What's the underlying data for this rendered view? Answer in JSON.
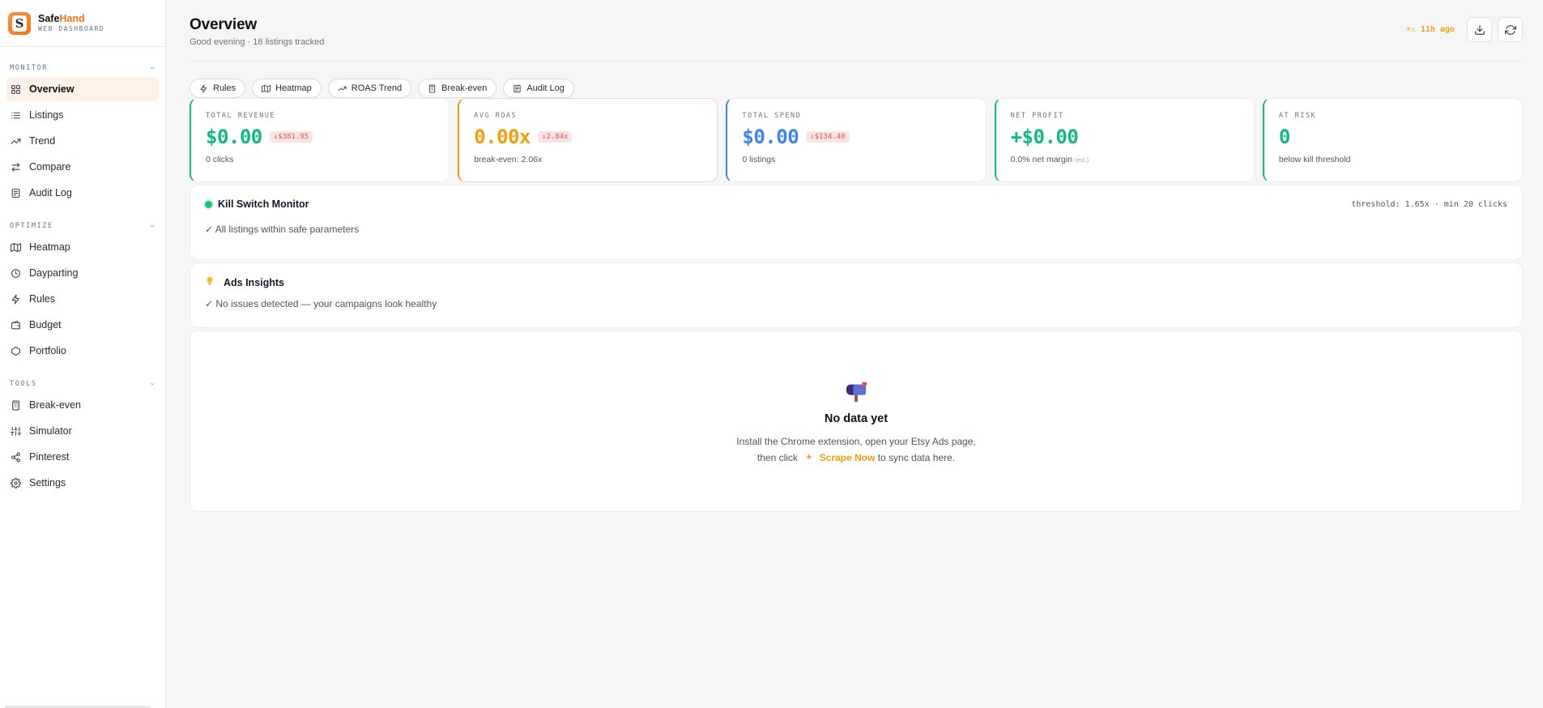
{
  "brand": {
    "name_main": "Safe",
    "name_accent": "Hand",
    "subtitle": "WEB DASHBOARD",
    "logo_letter": "S"
  },
  "sidebar": {
    "sections": [
      {
        "label": "MONITOR",
        "items": [
          {
            "label": "Overview",
            "icon": "grid-icon",
            "active": true
          },
          {
            "label": "Listings",
            "icon": "list-icon"
          },
          {
            "label": "Trend",
            "icon": "trend-icon"
          },
          {
            "label": "Compare",
            "icon": "compare-icon"
          },
          {
            "label": "Audit Log",
            "icon": "audit-icon"
          }
        ]
      },
      {
        "label": "OPTIMIZE",
        "items": [
          {
            "label": "Heatmap",
            "icon": "map-icon"
          },
          {
            "label": "Dayparting",
            "icon": "clock-icon"
          },
          {
            "label": "Rules",
            "icon": "bolt-icon"
          },
          {
            "label": "Budget",
            "icon": "wallet-icon"
          },
          {
            "label": "Portfolio",
            "icon": "hexagon-icon"
          }
        ]
      },
      {
        "label": "TOOLS",
        "items": [
          {
            "label": "Break-even",
            "icon": "calculator-icon"
          },
          {
            "label": "Simulator",
            "icon": "sliders-icon"
          },
          {
            "label": "Pinterest",
            "icon": "share-icon"
          },
          {
            "label": "Settings",
            "icon": "gear-icon"
          }
        ]
      }
    ]
  },
  "header": {
    "title": "Overview",
    "subtitle": "Good evening · 18 listings tracked",
    "last_sync": "☀⚠ 11h ago"
  },
  "quick_links": [
    {
      "label": "Rules",
      "icon": "bolt-icon"
    },
    {
      "label": "Heatmap",
      "icon": "map-icon"
    },
    {
      "label": "ROAS Trend",
      "icon": "trend-icon"
    },
    {
      "label": "Break-even",
      "icon": "calculator-icon"
    },
    {
      "label": "Audit Log",
      "icon": "audit-icon"
    }
  ],
  "stats": [
    {
      "label": "TOTAL REVENUE",
      "value": "$0.00",
      "delta": "↓$381.95",
      "sub": "0 clicks",
      "sub_note": "",
      "color": "#10b981"
    },
    {
      "label": "AVG ROAS",
      "value": "0.00x",
      "delta": "↓2.84x",
      "sub": "break-even: 2.06x",
      "sub_note": "",
      "color": "#f59e0b"
    },
    {
      "label": "TOTAL SPEND",
      "value": "$0.00",
      "delta": "↓$134.40",
      "sub": "0 listings",
      "sub_note": "",
      "color": "#3b82f6"
    },
    {
      "label": "NET PROFIT",
      "value": "+$0.00",
      "delta": "",
      "sub": "0.0% net margin",
      "sub_note": "est.",
      "color": "#10b981"
    },
    {
      "label": "AT RISK",
      "value": "0",
      "delta": "",
      "sub": "below kill threshold",
      "sub_note": "",
      "color": "#10b981"
    }
  ],
  "kill_switch": {
    "title": "Kill Switch Monitor",
    "threshold": "threshold: 1.65x · min 20 clicks",
    "message": "✓ All listings within safe parameters",
    "status_color": "#16c77a"
  },
  "insights": {
    "title": "Ads Insights",
    "message": "✓ No issues detected — your campaigns look healthy"
  },
  "empty_state": {
    "title": "No data yet",
    "line1": "Install the Chrome extension, open your Etsy Ads page,",
    "line2_before": "then click",
    "action": "Scrape Now",
    "line2_after": "to sync data here."
  }
}
